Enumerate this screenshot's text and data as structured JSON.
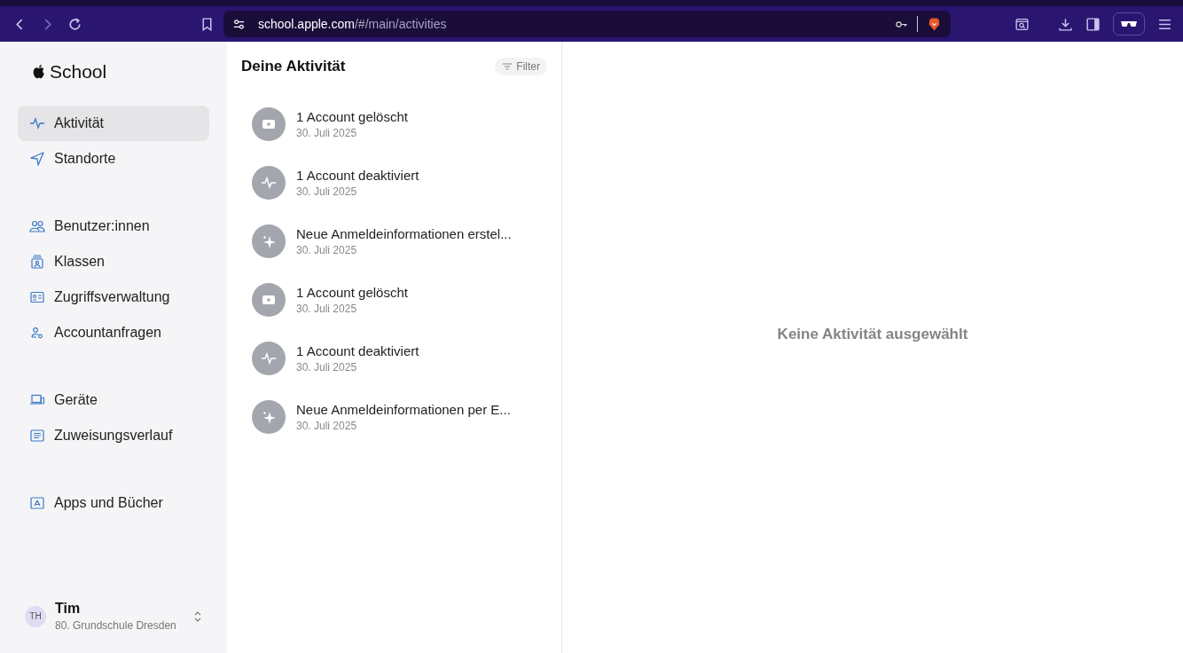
{
  "browser": {
    "url_host": "school.apple.com",
    "url_path": "/#/main/activities"
  },
  "sidebar": {
    "app_name": "School",
    "groups": [
      {
        "items": [
          {
            "label": "Aktivität",
            "kind": "pulse",
            "selected": true
          },
          {
            "label": "Standorte",
            "kind": "location",
            "selected": false
          }
        ]
      },
      {
        "items": [
          {
            "label": "Benutzer:innen",
            "kind": "people",
            "selected": false
          },
          {
            "label": "Klassen",
            "kind": "class",
            "selected": false
          },
          {
            "label": "Zugriffsverwaltung",
            "kind": "idcard",
            "selected": false
          },
          {
            "label": "Accountanfragen",
            "kind": "personcog",
            "selected": false
          }
        ]
      },
      {
        "items": [
          {
            "label": "Geräte",
            "kind": "devices",
            "selected": false
          },
          {
            "label": "Zuweisungsverlauf",
            "kind": "list",
            "selected": false
          }
        ]
      },
      {
        "items": [
          {
            "label": "Apps und Bücher",
            "kind": "apps",
            "selected": false
          }
        ]
      }
    ],
    "user": {
      "initials": "TH",
      "name": "Tim",
      "organization": "80. Grundschule Dresden"
    }
  },
  "activity": {
    "title": "Deine Aktivität",
    "filter": "Filter",
    "items": [
      {
        "kind": "device",
        "title": "1 Account gelöscht",
        "date": "30. Juli 2025"
      },
      {
        "kind": "pulse",
        "title": "1 Account deaktiviert",
        "date": "30. Juli 2025"
      },
      {
        "kind": "sparkle",
        "title": "Neue Anmeldeinformationen erstel...",
        "date": "30. Juli 2025"
      },
      {
        "kind": "device",
        "title": "1 Account gelöscht",
        "date": "30. Juli 2025"
      },
      {
        "kind": "pulse",
        "title": "1 Account deaktiviert",
        "date": "30. Juli 2025"
      },
      {
        "kind": "sparkle",
        "title": "Neue Anmeldeinformationen per E...",
        "date": "30. Juli 2025"
      }
    ]
  },
  "detail": {
    "empty_message": "Keine Aktivität ausgewählt"
  }
}
